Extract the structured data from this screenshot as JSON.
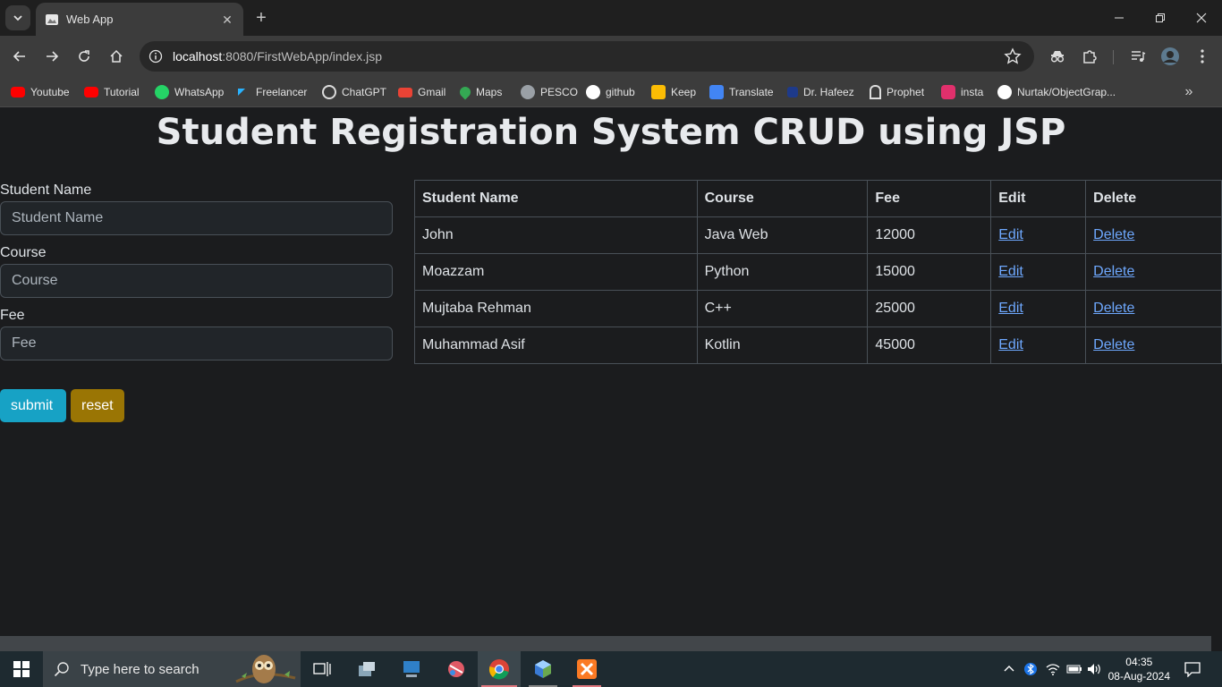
{
  "browser": {
    "tab_title": "Web App",
    "url_host": "localhost",
    "url_rest": ":8080/FirstWebApp/index.jsp"
  },
  "bookmarks": [
    {
      "label": "Youtube",
      "icon": "youtube-icon",
      "color": "#ff0000"
    },
    {
      "label": "Tutorial",
      "icon": "youtube-icon",
      "color": "#ff0000"
    },
    {
      "label": "WhatsApp",
      "icon": "whatsapp-icon",
      "color": "#25d366"
    },
    {
      "label": "Freelancer",
      "icon": "freelancer-icon",
      "color": "#29b2fe"
    },
    {
      "label": "ChatGPT",
      "icon": "chatgpt-icon",
      "color": "#ffffff"
    },
    {
      "label": "Gmail",
      "icon": "gmail-icon",
      "color": "#ea4335"
    },
    {
      "label": "Maps",
      "icon": "maps-icon",
      "color": "#34a853"
    },
    {
      "label": "PESCO",
      "icon": "globe-icon",
      "color": "#bdbdbd"
    },
    {
      "label": "github",
      "icon": "github-icon",
      "color": "#ffffff"
    },
    {
      "label": "Keep",
      "icon": "keep-icon",
      "color": "#fbbc04"
    },
    {
      "label": "Translate",
      "icon": "translate-icon",
      "color": "#4285f4"
    },
    {
      "label": "Dr. Hafeez",
      "icon": "hafeez-icon",
      "color": "#1e3a8a"
    },
    {
      "label": "Prophet",
      "icon": "prophet-icon",
      "color": "#ffffff"
    },
    {
      "label": "insta",
      "icon": "instagram-icon",
      "color": "#e1306c"
    },
    {
      "label": "Nurtak/ObjectGrap...",
      "icon": "github-icon",
      "color": "#ffffff"
    }
  ],
  "page": {
    "title": "Student Registration System CRUD using JSP",
    "form": {
      "name_label": "Student Name",
      "name_placeholder": "Student Name",
      "course_label": "Course",
      "course_placeholder": "Course",
      "fee_label": "Fee",
      "fee_placeholder": "Fee",
      "submit_label": "submit",
      "reset_label": "reset"
    },
    "table": {
      "headers": [
        "Student Name",
        "Course",
        "Fee",
        "Edit",
        "Delete"
      ],
      "rows": [
        {
          "name": "John",
          "course": "Java Web",
          "fee": "12000",
          "edit": "Edit",
          "delete": "Delete"
        },
        {
          "name": "Moazzam",
          "course": "Python",
          "fee": "15000",
          "edit": "Edit",
          "delete": "Delete"
        },
        {
          "name": "Mujtaba Rehman",
          "course": "C++",
          "fee": "25000",
          "edit": "Edit",
          "delete": "Delete"
        },
        {
          "name": "Muhammad Asif",
          "course": "Kotlin",
          "fee": "45000",
          "edit": "Edit",
          "delete": "Delete"
        }
      ]
    }
  },
  "taskbar": {
    "search_placeholder": "Type here to search",
    "time": "04:35",
    "date": "08-Aug-2024"
  },
  "colors": {
    "page_bg": "#1b1c1e",
    "submit": "#17a2c5",
    "reset": "#9a7504",
    "link": "#6ea8fe"
  }
}
